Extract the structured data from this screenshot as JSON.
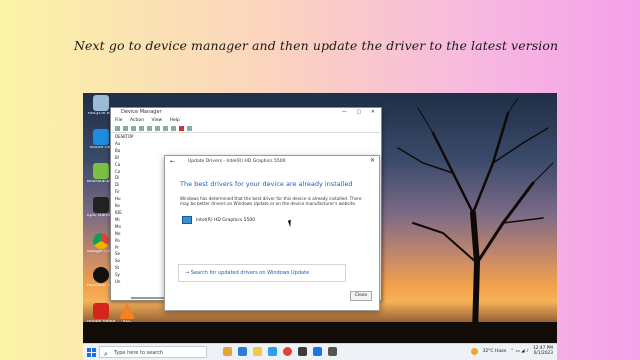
{
  "caption": "Next go to device manager and then update the driver to the latest version",
  "desktop_icons": [
    {
      "label": "Recycle Bin",
      "color": "#9bbad6"
    },
    {
      "label": "Battle.net",
      "color": "#1d8be0"
    },
    {
      "label": "BlueStacks 5",
      "color": "#7ac143"
    },
    {
      "label": "Epic Games Launcher",
      "color": "#222222"
    },
    {
      "label": "Google Chrome",
      "color": "#e7b21b"
    },
    {
      "label": "Rockstar Games",
      "color": "#f0f0f0"
    },
    {
      "label": "Adobe Reader",
      "color": "#d2261c"
    },
    {
      "label": "VLC",
      "color": "#f58220"
    }
  ],
  "device_manager": {
    "title": "Device Manager",
    "window_buttons": "— ▢ ✕",
    "menu": [
      "File",
      "Action",
      "View",
      "Help"
    ],
    "tree_root": "DESKTOP",
    "tree_items": [
      "Au",
      "Ba",
      "Bl",
      "Ca",
      "Co",
      "Di",
      "Di",
      "Fir",
      "Hu",
      "Ke",
      "IDE",
      "Mi",
      "Mo",
      "Ne",
      "Po",
      "Pr",
      "Se",
      "So",
      "St",
      "Sy",
      "Un"
    ]
  },
  "update_dialog": {
    "back_glyph": "←",
    "close_glyph": "✕",
    "title": "Update Drivers - Intel(R) HD Graphics 5500",
    "heading": "The best drivers for your device are already installed",
    "description": "Windows has determined that the best driver for this device is already installed. There may be better drivers on Windows Update or on the device manufacturer's website.",
    "device_name": "Intel(R) HD Graphics 5500",
    "search_link": "→ Search for updated drivers on Windows Update",
    "close_button": "Close"
  },
  "taskbar": {
    "search_glyph": "⌕",
    "search_placeholder": "Type here to search",
    "apps": [
      "#e8a33d",
      "#2b7cd3",
      "#f2c94c",
      "#2aa0e8",
      "#db4437",
      "#3c3c3c",
      "#1a73e8",
      "#555555"
    ],
    "weather": "32°C Haze",
    "time": "12:47 PM",
    "date": "6/1/2023"
  }
}
